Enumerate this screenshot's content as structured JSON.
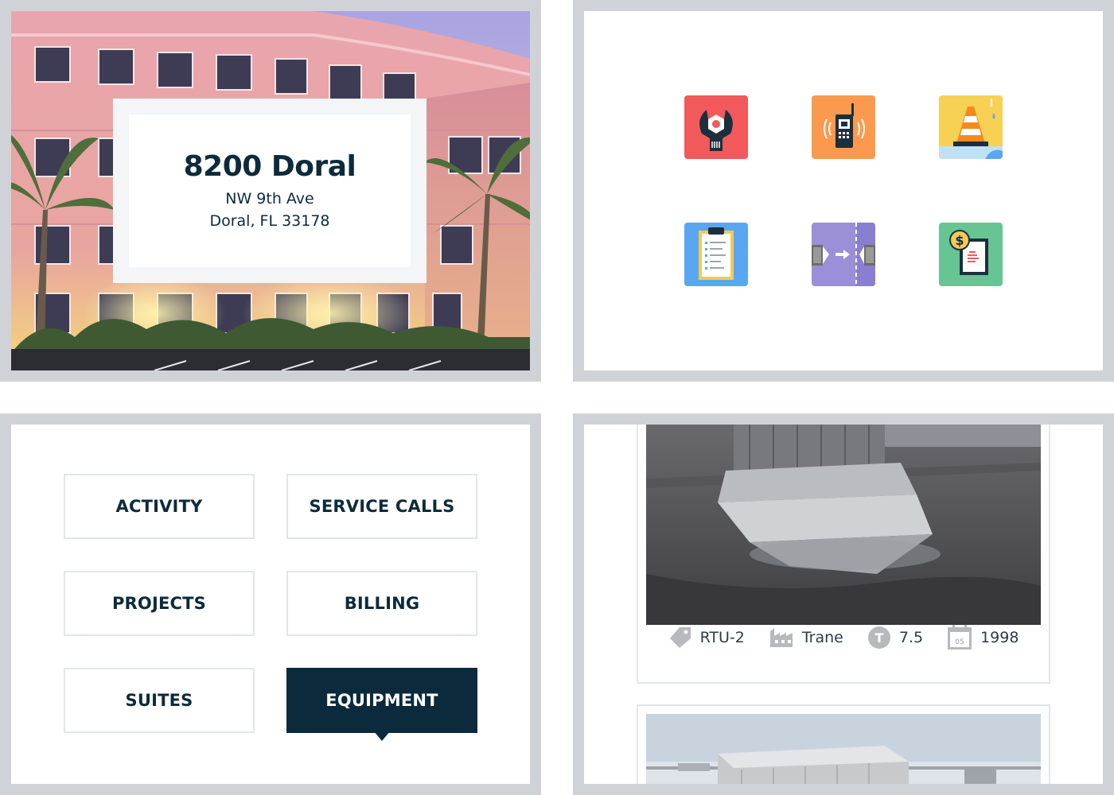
{
  "property": {
    "name": "8200 Doral",
    "address_line1": "NW 9th Ave",
    "address_line2": "Doral, FL 33178"
  },
  "service_icons": [
    {
      "icon": "wrench-nut-icon",
      "color": "#f2595b"
    },
    {
      "icon": "walkie-talkie-icon",
      "color": "#fb9a4f"
    },
    {
      "icon": "traffic-cone-icon",
      "color": "#f7d154"
    },
    {
      "icon": "clipboard-icon",
      "color": "#5aa7f1"
    },
    {
      "icon": "move-transfer-icon",
      "color": "#9b8fd8"
    },
    {
      "icon": "invoice-icon",
      "color": "#66c593"
    }
  ],
  "nav": {
    "activity": "ACTIVITY",
    "service_calls": "SERVICE CALLS",
    "projects": "PROJECTS",
    "billing": "BILLING",
    "suites": "SUITES",
    "equipment": "EQUIPMENT",
    "active": "EQUIPMENT"
  },
  "equipment": [
    {
      "tag": "RTU-2",
      "manufacturer": "Trane",
      "tonnage": "7.5",
      "year": "1998",
      "calendar_day": "05"
    }
  ],
  "colors": {
    "navy": "#0b2a3c",
    "frame": "#cfd3d7",
    "border": "#e3e6e9"
  }
}
